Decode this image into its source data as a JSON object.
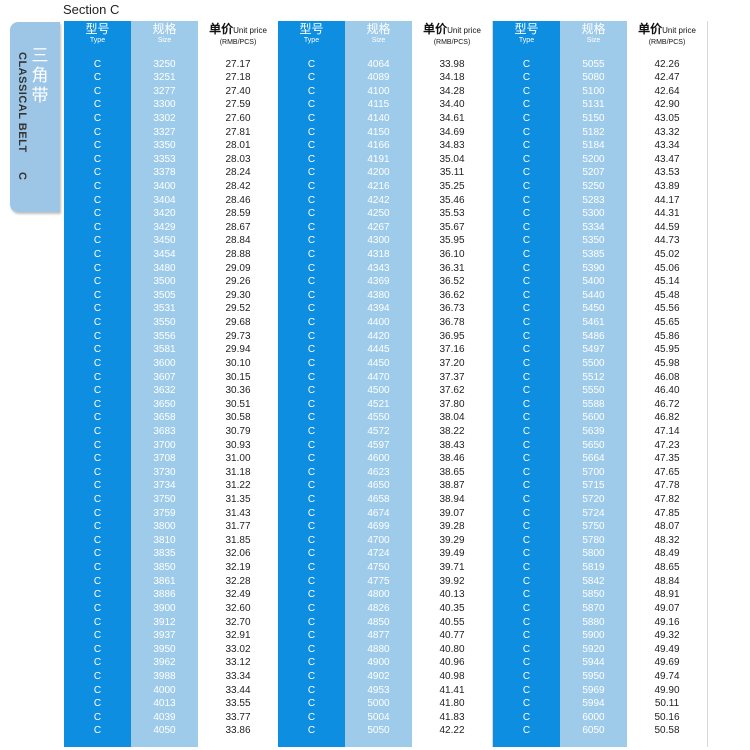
{
  "section_title": "Section C",
  "side_tab": {
    "zh": "三角带",
    "en": "CLASSICAL BELT",
    "code": "C"
  },
  "headers": {
    "type_zh": "型号",
    "type_en": "Type",
    "size_zh": "规格",
    "size_en": "Size",
    "price_zh": "单价",
    "price_unit": "Unit price",
    "price_en": "(RMB/PCS)"
  },
  "groups": [
    {
      "rows": [
        [
          "C",
          "3250",
          "27.17"
        ],
        [
          "C",
          "3251",
          "27.18"
        ],
        [
          "C",
          "3277",
          "27.40"
        ],
        [
          "C",
          "3300",
          "27.59"
        ],
        [
          "C",
          "3302",
          "27.60"
        ],
        [
          "C",
          "3327",
          "27.81"
        ],
        [
          "C",
          "3350",
          "28.01"
        ],
        [
          "C",
          "3353",
          "28.03"
        ],
        [
          "C",
          "3378",
          "28.24"
        ],
        [
          "C",
          "3400",
          "28.42"
        ],
        [
          "C",
          "3404",
          "28.46"
        ],
        [
          "C",
          "3420",
          "28.59"
        ],
        [
          "C",
          "3429",
          "28.67"
        ],
        [
          "C",
          "3450",
          "28.84"
        ],
        [
          "C",
          "3454",
          "28.88"
        ],
        [
          "C",
          "3480",
          "29.09"
        ],
        [
          "C",
          "3500",
          "29.26"
        ],
        [
          "C",
          "3505",
          "29.30"
        ],
        [
          "C",
          "3531",
          "29.52"
        ],
        [
          "C",
          "3550",
          "29.68"
        ],
        [
          "C",
          "3556",
          "29.73"
        ],
        [
          "C",
          "3581",
          "29.94"
        ],
        [
          "C",
          "3600",
          "30.10"
        ],
        [
          "C",
          "3607",
          "30.15"
        ],
        [
          "C",
          "3632",
          "30.36"
        ],
        [
          "C",
          "3650",
          "30.51"
        ],
        [
          "C",
          "3658",
          "30.58"
        ],
        [
          "C",
          "3683",
          "30.79"
        ],
        [
          "C",
          "3700",
          "30.93"
        ],
        [
          "C",
          "3708",
          "31.00"
        ],
        [
          "C",
          "3730",
          "31.18"
        ],
        [
          "C",
          "3734",
          "31.22"
        ],
        [
          "C",
          "3750",
          "31.35"
        ],
        [
          "C",
          "3759",
          "31.43"
        ],
        [
          "C",
          "3800",
          "31.77"
        ],
        [
          "C",
          "3810",
          "31.85"
        ],
        [
          "C",
          "3835",
          "32.06"
        ],
        [
          "C",
          "3850",
          "32.19"
        ],
        [
          "C",
          "3861",
          "32.28"
        ],
        [
          "C",
          "3886",
          "32.49"
        ],
        [
          "C",
          "3900",
          "32.60"
        ],
        [
          "C",
          "3912",
          "32.70"
        ],
        [
          "C",
          "3937",
          "32.91"
        ],
        [
          "C",
          "3950",
          "33.02"
        ],
        [
          "C",
          "3962",
          "33.12"
        ],
        [
          "C",
          "3988",
          "33.34"
        ],
        [
          "C",
          "4000",
          "33.44"
        ],
        [
          "C",
          "4013",
          "33.55"
        ],
        [
          "C",
          "4039",
          "33.77"
        ],
        [
          "C",
          "4050",
          "33.86"
        ]
      ]
    },
    {
      "rows": [
        [
          "C",
          "4064",
          "33.98"
        ],
        [
          "C",
          "4089",
          "34.18"
        ],
        [
          "C",
          "4100",
          "34.28"
        ],
        [
          "C",
          "4115",
          "34.40"
        ],
        [
          "C",
          "4140",
          "34.61"
        ],
        [
          "C",
          "4150",
          "34.69"
        ],
        [
          "C",
          "4166",
          "34.83"
        ],
        [
          "C",
          "4191",
          "35.04"
        ],
        [
          "C",
          "4200",
          "35.11"
        ],
        [
          "C",
          "4216",
          "35.25"
        ],
        [
          "C",
          "4242",
          "35.46"
        ],
        [
          "C",
          "4250",
          "35.53"
        ],
        [
          "C",
          "4267",
          "35.67"
        ],
        [
          "C",
          "4300",
          "35.95"
        ],
        [
          "C",
          "4318",
          "36.10"
        ],
        [
          "C",
          "4343",
          "36.31"
        ],
        [
          "C",
          "4369",
          "36.52"
        ],
        [
          "C",
          "4380",
          "36.62"
        ],
        [
          "C",
          "4394",
          "36.73"
        ],
        [
          "C",
          "4400",
          "36.78"
        ],
        [
          "C",
          "4420",
          "36.95"
        ],
        [
          "C",
          "4445",
          "37.16"
        ],
        [
          "C",
          "4450",
          "37.20"
        ],
        [
          "C",
          "4470",
          "37.37"
        ],
        [
          "C",
          "4500",
          "37.62"
        ],
        [
          "C",
          "4521",
          "37.80"
        ],
        [
          "C",
          "4550",
          "38.04"
        ],
        [
          "C",
          "4572",
          "38.22"
        ],
        [
          "C",
          "4597",
          "38.43"
        ],
        [
          "C",
          "4600",
          "38.46"
        ],
        [
          "C",
          "4623",
          "38.65"
        ],
        [
          "C",
          "4650",
          "38.87"
        ],
        [
          "C",
          "4658",
          "38.94"
        ],
        [
          "C",
          "4674",
          "39.07"
        ],
        [
          "C",
          "4699",
          "39.28"
        ],
        [
          "C",
          "4700",
          "39.29"
        ],
        [
          "C",
          "4724",
          "39.49"
        ],
        [
          "C",
          "4750",
          "39.71"
        ],
        [
          "C",
          "4775",
          "39.92"
        ],
        [
          "C",
          "4800",
          "40.13"
        ],
        [
          "C",
          "4826",
          "40.35"
        ],
        [
          "C",
          "4850",
          "40.55"
        ],
        [
          "C",
          "4877",
          "40.77"
        ],
        [
          "C",
          "4880",
          "40.80"
        ],
        [
          "C",
          "4900",
          "40.96"
        ],
        [
          "C",
          "4902",
          "40.98"
        ],
        [
          "C",
          "4953",
          "41.41"
        ],
        [
          "C",
          "5000",
          "41.80"
        ],
        [
          "C",
          "5004",
          "41.83"
        ],
        [
          "C",
          "5050",
          "42.22"
        ]
      ]
    },
    {
      "rows": [
        [
          "C",
          "5055",
          "42.26"
        ],
        [
          "C",
          "5080",
          "42.47"
        ],
        [
          "C",
          "5100",
          "42.64"
        ],
        [
          "C",
          "5131",
          "42.90"
        ],
        [
          "C",
          "5150",
          "43.05"
        ],
        [
          "C",
          "5182",
          "43.32"
        ],
        [
          "C",
          "5184",
          "43.34"
        ],
        [
          "C",
          "5200",
          "43.47"
        ],
        [
          "C",
          "5207",
          "43.53"
        ],
        [
          "C",
          "5250",
          "43.89"
        ],
        [
          "C",
          "5283",
          "44.17"
        ],
        [
          "C",
          "5300",
          "44.31"
        ],
        [
          "C",
          "5334",
          "44.59"
        ],
        [
          "C",
          "5350",
          "44.73"
        ],
        [
          "C",
          "5385",
          "45.02"
        ],
        [
          "C",
          "5390",
          "45.06"
        ],
        [
          "C",
          "5400",
          "45.14"
        ],
        [
          "C",
          "5440",
          "45.48"
        ],
        [
          "C",
          "5450",
          "45.56"
        ],
        [
          "C",
          "5461",
          "45.65"
        ],
        [
          "C",
          "5486",
          "45.86"
        ],
        [
          "C",
          "5497",
          "45.95"
        ],
        [
          "C",
          "5500",
          "45.98"
        ],
        [
          "C",
          "5512",
          "46.08"
        ],
        [
          "C",
          "5550",
          "46.40"
        ],
        [
          "C",
          "5588",
          "46.72"
        ],
        [
          "C",
          "5600",
          "46.82"
        ],
        [
          "C",
          "5639",
          "47.14"
        ],
        [
          "C",
          "5650",
          "47.23"
        ],
        [
          "C",
          "5664",
          "47.35"
        ],
        [
          "C",
          "5700",
          "47.65"
        ],
        [
          "C",
          "5715",
          "47.78"
        ],
        [
          "C",
          "5720",
          "47.82"
        ],
        [
          "C",
          "5724",
          "47.85"
        ],
        [
          "C",
          "5750",
          "48.07"
        ],
        [
          "C",
          "5780",
          "48.32"
        ],
        [
          "C",
          "5800",
          "48.49"
        ],
        [
          "C",
          "5819",
          "48.65"
        ],
        [
          "C",
          "5842",
          "48.84"
        ],
        [
          "C",
          "5850",
          "48.91"
        ],
        [
          "C",
          "5870",
          "49.07"
        ],
        [
          "C",
          "5880",
          "49.16"
        ],
        [
          "C",
          "5900",
          "49.32"
        ],
        [
          "C",
          "5920",
          "49.49"
        ],
        [
          "C",
          "5944",
          "49.69"
        ],
        [
          "C",
          "5950",
          "49.74"
        ],
        [
          "C",
          "5969",
          "49.90"
        ],
        [
          "C",
          "5994",
          "50.11"
        ],
        [
          "C",
          "6000",
          "50.16"
        ],
        [
          "C",
          "6050",
          "50.58"
        ]
      ]
    }
  ]
}
